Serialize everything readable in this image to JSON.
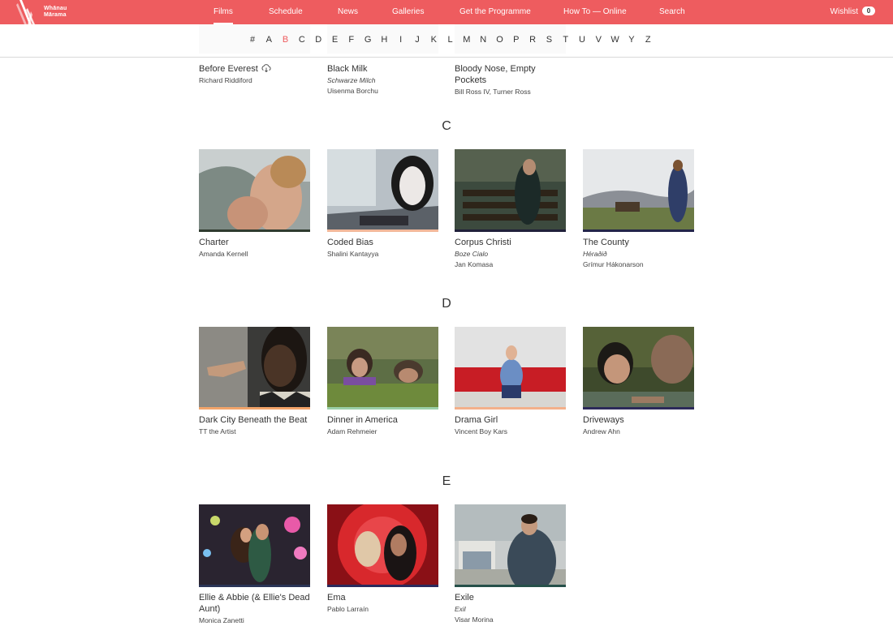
{
  "brand": {
    "logo_text": "Whānau Mārama",
    "accent": "#ee5c5f"
  },
  "nav": {
    "items": [
      {
        "label": "Films",
        "active": true
      },
      {
        "label": "Schedule"
      },
      {
        "label": "News"
      },
      {
        "label": "Galleries"
      },
      {
        "label": "Get the Programme"
      },
      {
        "label": "How To — Online"
      },
      {
        "label": "Search"
      }
    ],
    "wishlist_label": "Wishlist",
    "wishlist_count": "0"
  },
  "alphabet": {
    "letters": [
      "#",
      "A",
      "B",
      "C",
      "D",
      "E",
      "F",
      "G",
      "H",
      "I",
      "J",
      "K",
      "L",
      "M",
      "N",
      "O",
      "P",
      "R",
      "S",
      "T",
      "U",
      "V",
      "W",
      "Y",
      "Z"
    ],
    "current": "B"
  },
  "sections": {
    "b": {
      "films": [
        {
          "title": "Before Everest",
          "director": "Richard Riddiford",
          "icon": "download-icon"
        },
        {
          "title": "Black Milk",
          "alt_title": "Schwarze Milch",
          "director": "Uisenma Borchu"
        },
        {
          "title": "Bloody Nose, Empty Pockets",
          "director": "Bill Ross IV, Turner Ross"
        }
      ]
    },
    "c": {
      "letter": "C",
      "films": [
        {
          "title": "Charter",
          "director": "Amanda Kernell",
          "bar": "#2f3b2f"
        },
        {
          "title": "Coded Bias",
          "director": "Shalini Kantayya",
          "bar": "#f2b89a"
        },
        {
          "title": "Corpus Christi",
          "alt_title": "Boze Cialo",
          "director": "Jan Komasa",
          "bar": "#20203a"
        },
        {
          "title": "The County",
          "alt_title": "Héraðið",
          "director": "Grímur Hákonarson",
          "bar": "#22244a"
        }
      ]
    },
    "d": {
      "letter": "D",
      "films": [
        {
          "title": "Dark City Beneath the Beat",
          "director": "TT the Artist",
          "bar": "#f2a46a"
        },
        {
          "title": "Dinner in America",
          "director": "Adam Rehmeier",
          "bar": "#9ad0a8"
        },
        {
          "title": "Drama Girl",
          "director": "Vincent Boy Kars",
          "bar": "#f3b08a"
        },
        {
          "title": "Driveways",
          "director": "Andrew Ahn",
          "bar": "#2c2a5a"
        }
      ]
    },
    "e": {
      "letter": "E",
      "films": [
        {
          "title": "Ellie & Abbie (& Ellie's Dead Aunt)",
          "director": "Monica Zanetti",
          "bar": "#2a3456"
        },
        {
          "title": "Ema",
          "director": "Pablo Larraín",
          "bar": "#2b2a5c"
        },
        {
          "title": "Exile",
          "alt_title": "Exil",
          "director": "Visar Morina",
          "bar": "#26504a"
        }
      ]
    }
  }
}
